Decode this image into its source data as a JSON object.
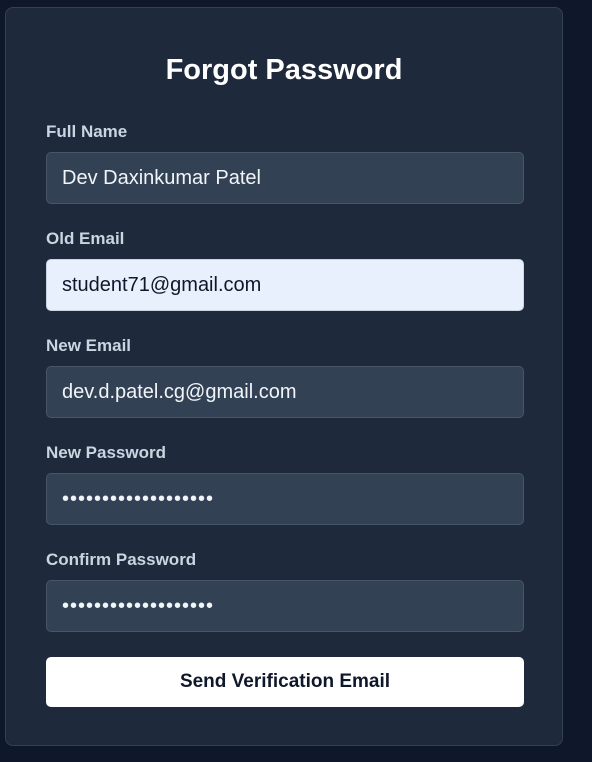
{
  "form": {
    "title": "Forgot Password",
    "fields": [
      {
        "label": "Full Name",
        "value": "Dev Daxinkumar Patel",
        "type": "text"
      },
      {
        "label": "Old Email",
        "value": "student71@gmail.com",
        "type": "email"
      },
      {
        "label": "New Email",
        "value": "dev.d.patel.cg@gmail.com",
        "type": "email"
      },
      {
        "label": "New Password",
        "value": "•••••••••••••••••••",
        "type": "password"
      },
      {
        "label": "Confirm Password",
        "value": "•••••••••••••••••••",
        "type": "password"
      }
    ],
    "submit_label": "Send Verification Email"
  },
  "colors": {
    "page_background": "#0f172a",
    "card_background": "#1e293b",
    "input_background": "#334155",
    "autofill_background": "#e8f0fe",
    "button_background": "#ffffff"
  }
}
